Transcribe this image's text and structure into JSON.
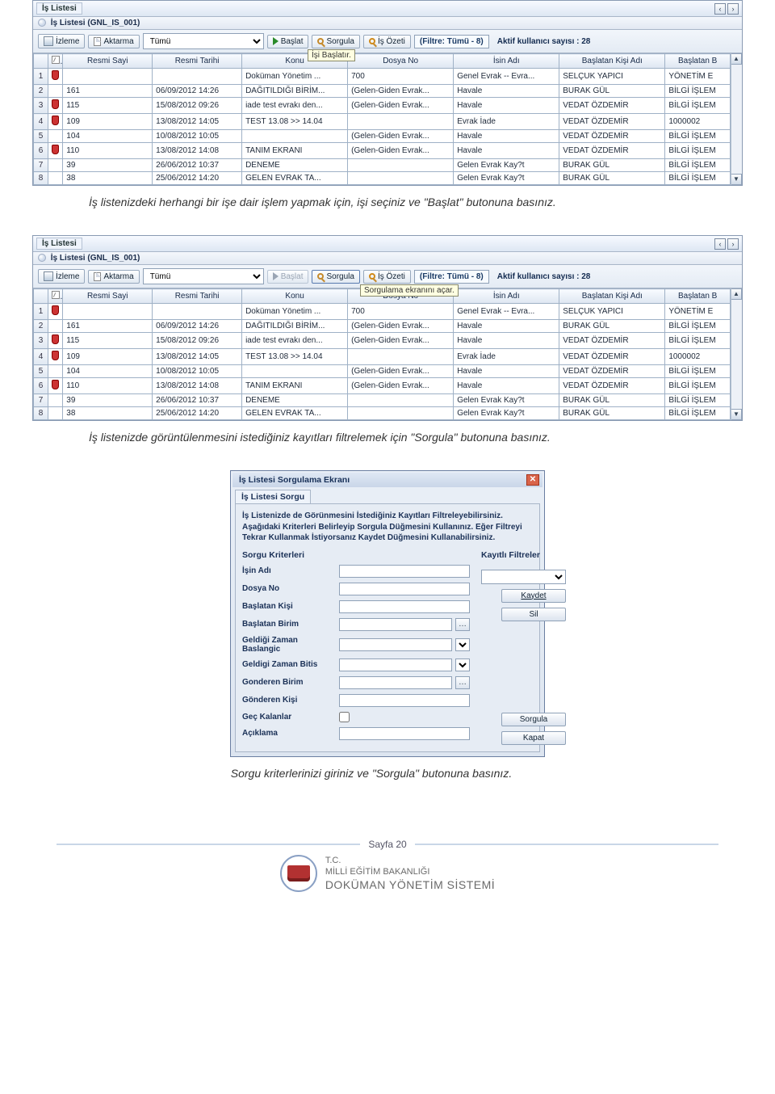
{
  "panel": {
    "title": "İş Listesi",
    "subtitle": "İş Listesi (GNL_IS_001)"
  },
  "toolbar": {
    "izleme": "İzleme",
    "aktarma": "Aktarma",
    "dropdown_value": "Tümü",
    "baslat": "Başlat",
    "sorgula": "Sorgula",
    "ozet": "İş Özeti",
    "filtre": "(Filtre: Tümü - 8)",
    "aktif": "Aktif kullanıcı sayısı : 28"
  },
  "tooltips": {
    "baslat": "İşi Başlatır.",
    "sorgula": "Sorgulama ekranını açar."
  },
  "columns": [
    "",
    "",
    "Resmi Sayi",
    "Resmi Tarihi",
    "Konu",
    "Dosya No",
    "İsin Adı",
    "Başlatan Kişi Adı",
    "Başlatan B"
  ],
  "rows": [
    {
      "n": "1",
      "pin": true,
      "s": "",
      "t": "",
      "k": "Doküman Yönetim ...",
      "d": "700",
      "a": "Genel Evrak -- Evra...",
      "kisi": "SELÇUK YAPICI",
      "b": "YÖNETİM E"
    },
    {
      "n": "2",
      "pin": false,
      "s": "161",
      "t": "06/09/2012 14:26",
      "k": "DAĞITILDIĞI BİRİM...",
      "d": "(Gelen-Giden Evrak...",
      "a": "Havale",
      "kisi": "BURAK GÜL",
      "b": "BİLGİ İŞLEM"
    },
    {
      "n": "3",
      "pin": true,
      "s": "115",
      "t": "15/08/2012 09:26",
      "k": "iade test evrakı den...",
      "d": "(Gelen-Giden Evrak...",
      "a": "Havale",
      "kisi": "VEDAT ÖZDEMİR",
      "b": "BİLGİ İŞLEM"
    },
    {
      "n": "4",
      "pin": true,
      "s": "109",
      "t": "13/08/2012 14:05",
      "k": "TEST 13.08 >> 14.04",
      "d": "",
      "a": "Evrak İade",
      "kisi": "VEDAT ÖZDEMİR",
      "b": "1000002"
    },
    {
      "n": "5",
      "pin": false,
      "s": "104",
      "t": "10/08/2012 10:05",
      "k": "",
      "d": "(Gelen-Giden Evrak...",
      "a": "Havale",
      "kisi": "VEDAT ÖZDEMİR",
      "b": "BİLGİ İŞLEM"
    },
    {
      "n": "6",
      "pin": true,
      "s": "110",
      "t": "13/08/2012 14:08",
      "k": "TANIM EKRANI",
      "d": "(Gelen-Giden Evrak...",
      "a": "Havale",
      "kisi": "VEDAT ÖZDEMİR",
      "b": "BİLGİ İŞLEM"
    },
    {
      "n": "7",
      "pin": false,
      "s": "39",
      "t": "26/06/2012 10:37",
      "k": "DENEME",
      "d": "",
      "a": "Gelen Evrak Kay?t",
      "kisi": "BURAK GÜL",
      "b": "BİLGİ İŞLEM"
    },
    {
      "n": "8",
      "pin": false,
      "s": "38",
      "t": "25/06/2012 14:20",
      "k": "GELEN EVRAK TA...",
      "d": "",
      "a": "Gelen Evrak Kay?t",
      "kisi": "BURAK GÜL",
      "b": "BİLGİ İŞLEM"
    }
  ],
  "captions": {
    "c1": "İş listenizdeki herhangi bir işe dair işlem yapmak için, işi seçiniz ve \"Başlat\" butonuna basınız.",
    "c2": "İş listenizde görüntülenmesini istediğiniz kayıtları filtrelemek için \"Sorgula\" butonuna basınız.",
    "c3": "Sorgu kriterlerinizi giriniz ve \"Sorgula\" butonuna basınız."
  },
  "dialog": {
    "title": "İş Listesi Sorgulama Ekranı",
    "tab": "İş Listesi Sorgu",
    "help": "İş Listenizde de Görünmesini İstediğiniz Kayıtları Filtreleyebilirsiniz. Aşağıdaki Kriterleri Belirleyip Sorgula Düğmesini Kullanınız. Eğer Filtreyi Tekrar Kullanmak İstiyorsanız Kaydet Düğmesini Kullanabilirsiniz.",
    "left_heading": "Sorgu Kriterleri",
    "right_heading": "Kayıtlı Filtreler",
    "fields": {
      "isin_adi": "İşin Adı",
      "dosya_no": "Dosya No",
      "baslatan_kisi": "Başlatan Kişi",
      "baslatan_birim": "Başlatan Birim",
      "geldigi_baslangic": "Geldiği Zaman Baslangic",
      "geldigi_bitis": "Geldigi Zaman Bitis",
      "gonderen_birim": "Gonderen Birim",
      "gonderen_kisi": "Gönderen Kişi",
      "gec_kalanlar": "Geç Kalanlar",
      "aciklama": "Açıklama"
    },
    "buttons": {
      "kaydet": "Kaydet",
      "sil": "Sil",
      "sorgula": "Sorgula",
      "kapat": "Kapat"
    }
  },
  "footer": {
    "page": "Sayfa 20",
    "line1": "T.C.",
    "line2": "MİLLİ EĞİTİM BAKANLIĞI",
    "line3": "DOKÜMAN YÖNETİM SİSTEMİ"
  }
}
